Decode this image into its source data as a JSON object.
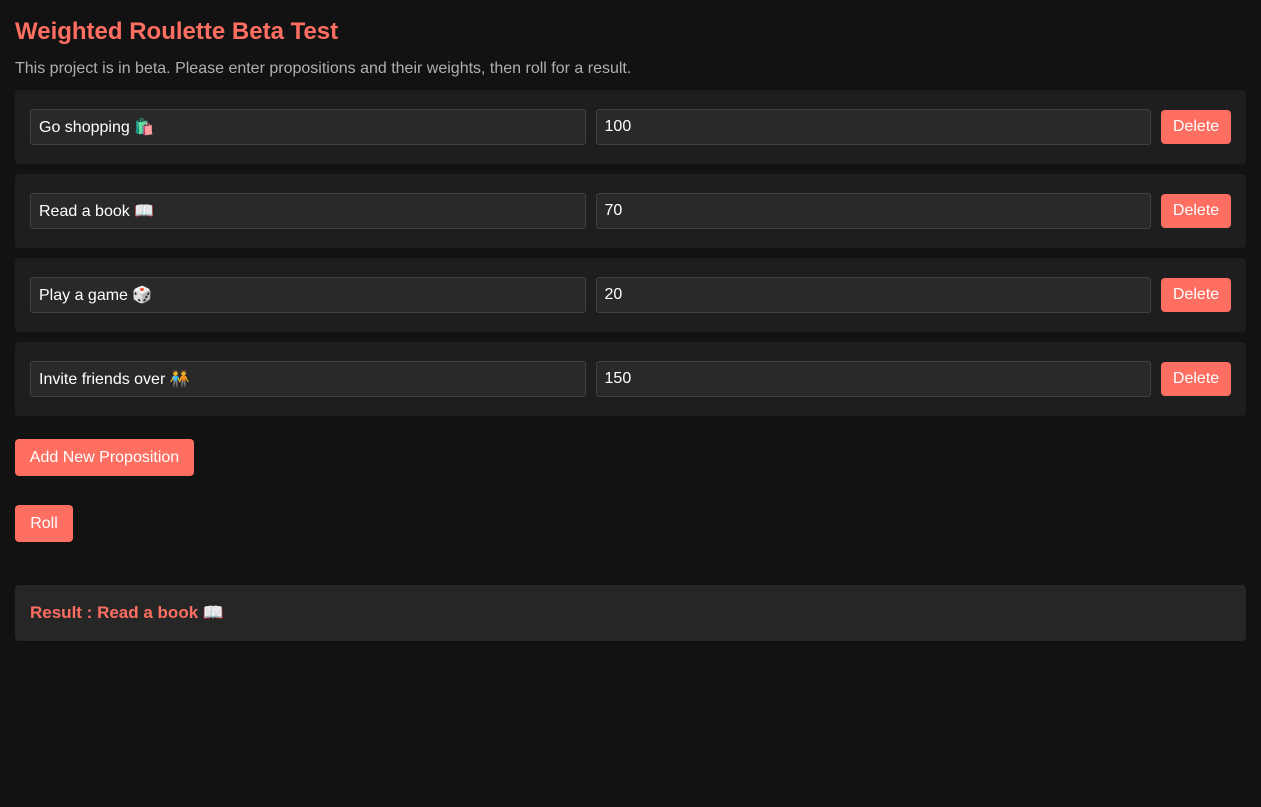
{
  "header": {
    "title": "Weighted Roulette Beta Test",
    "subtitle": "This project is in beta. Please enter propositions and their weights, then roll for a result."
  },
  "propositions": [
    {
      "name": "Go shopping 🛍️",
      "weight": "100",
      "delete_label": "Delete"
    },
    {
      "name": "Read a book 📖",
      "weight": "70",
      "delete_label": "Delete"
    },
    {
      "name": "Play a game 🎲",
      "weight": "20",
      "delete_label": "Delete"
    },
    {
      "name": "Invite friends over 🧑‍🤝‍🧑",
      "weight": "150",
      "delete_label": "Delete"
    }
  ],
  "actions": {
    "add_label": "Add New Proposition",
    "roll_label": "Roll"
  },
  "result": {
    "label": "Result :",
    "value": "Read a book 📖"
  },
  "colors": {
    "accent": "#ff6f61",
    "background": "#121212",
    "card": "#1e1e1e"
  }
}
